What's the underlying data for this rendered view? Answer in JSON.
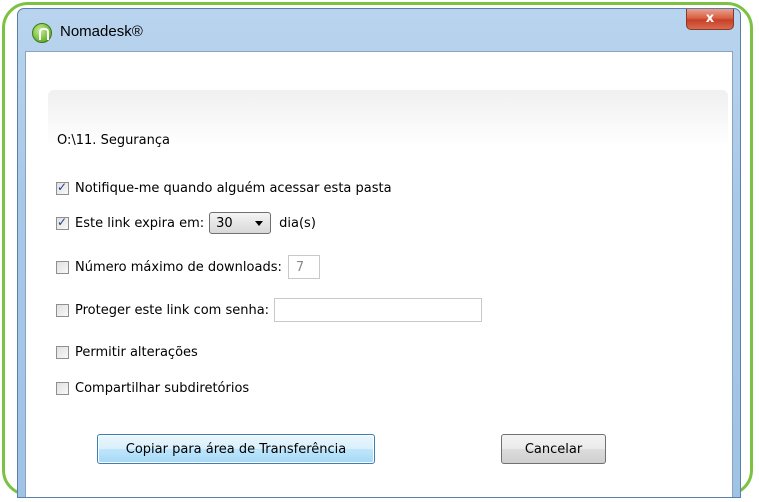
{
  "window": {
    "title": "Nomadesk®",
    "close_glyph": "x"
  },
  "dialog": {
    "path": "O:\\11. Segurança",
    "notify": {
      "label": "Notifique-me quando alguém acessar esta pasta",
      "checked": true
    },
    "expire": {
      "label": "Este link expira em:",
      "checked": true,
      "days_value": "30",
      "days_suffix": "dia(s)"
    },
    "max_downloads": {
      "label": "Número máximo de downloads:",
      "checked": false,
      "value": "7"
    },
    "password": {
      "label": "Proteger este link com senha:",
      "checked": false,
      "value": ""
    },
    "allow_changes": {
      "label": "Permitir alterações",
      "checked": false
    },
    "share_subdirs": {
      "label": "Compartilhar subdiretórios",
      "checked": false
    },
    "buttons": {
      "copy": "Copiar para área de Transferência",
      "cancel": "Cancelar"
    }
  },
  "colors": {
    "frame_accent": "#7cc242",
    "window_chrome": "#a8c8e8",
    "close_button": "#c7402a"
  }
}
